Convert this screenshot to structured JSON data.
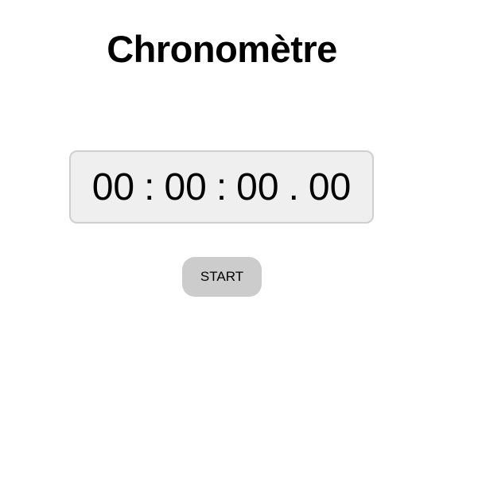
{
  "page": {
    "title": "Chronomètre"
  },
  "timer": {
    "hours": "00",
    "minutes": "00",
    "seconds": "00",
    "hundredths": "00",
    "sep_hm": ":",
    "sep_ms": ":",
    "sep_sh": "."
  },
  "controls": {
    "start_label": "START"
  },
  "colors": {
    "display_background": "#efefef",
    "display_border": "#cfcfcf",
    "button_background": "#cccccc",
    "text": "#000000"
  }
}
